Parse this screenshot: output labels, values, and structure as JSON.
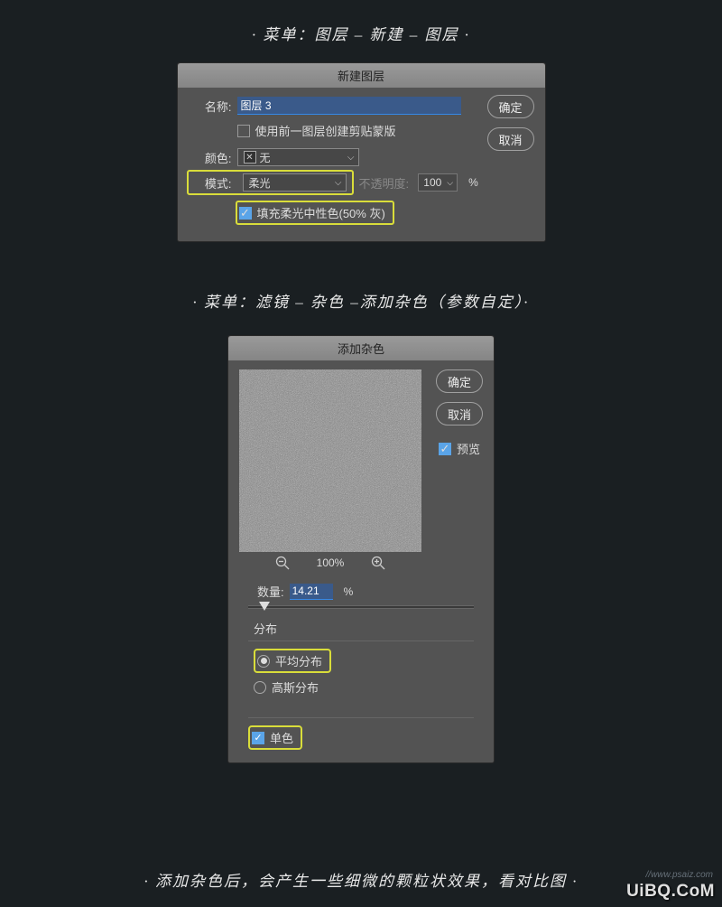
{
  "caption1": "· 菜单：图层 – 新建 – 图层 ·",
  "caption2": "· 菜单：滤镜 – 杂色 –添加杂色（参数自定）·",
  "caption3": "· 添加杂色后，会产生一些细微的颗粒状效果，看对比图 ·",
  "dialog1": {
    "title": "新建图层",
    "ok": "确定",
    "cancel": "取消",
    "name_label": "名称:",
    "name_value": "图层 3",
    "clip_label": "使用前一图层创建剪贴蒙版",
    "color_label": "颜色:",
    "color_value": "无",
    "mode_label": "模式:",
    "mode_value": "柔光",
    "opacity_label": "不透明度:",
    "opacity_value": "100",
    "opacity_pct": "%",
    "fill_label": "填充柔光中性色(50% 灰)"
  },
  "dialog2": {
    "title": "添加杂色",
    "ok": "确定",
    "cancel": "取消",
    "preview_label": "预览",
    "zoom_pct": "100%",
    "amount_label": "数量:",
    "amount_value": "14.21",
    "amount_pct": "%",
    "dist_label": "分布",
    "uniform": "平均分布",
    "gaussian": "高斯分布",
    "mono": "单色"
  },
  "watermark": "UiBQ.CoM",
  "watermark_sub": "//www.psaiz.com"
}
